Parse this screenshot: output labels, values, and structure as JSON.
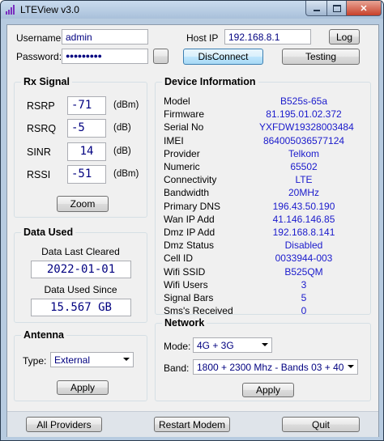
{
  "window": {
    "title": "LTEView v3.0"
  },
  "login": {
    "username_label": "Username:",
    "username_value": "admin",
    "password_label": "Password:",
    "password_value": "●●●●●●●●●",
    "host_label": "Host IP",
    "host_value": "192.168.8.1",
    "log_button": "Log",
    "disconnect_button": "DisConnect",
    "testing_button": "Testing"
  },
  "rx_signal": {
    "title": "Rx Signal",
    "rows": [
      {
        "label": "RSRP",
        "value": "-71",
        "unit": "(dBm)"
      },
      {
        "label": "RSRQ",
        "value": "-5",
        "unit": "(dB)"
      },
      {
        "label": "SINR",
        "value": "14",
        "unit": "(dB)"
      },
      {
        "label": "RSSI",
        "value": "-51",
        "unit": "(dBm)"
      }
    ],
    "zoom_button": "Zoom"
  },
  "data_used": {
    "title": "Data Used",
    "last_cleared_label": "Data Last Cleared",
    "last_cleared_value": "2022-01-01",
    "used_since_label": "Data Used Since",
    "used_since_value": "15.567 GB"
  },
  "antenna": {
    "title": "Antenna",
    "type_label": "Type:",
    "type_value": "External",
    "apply_button": "Apply"
  },
  "device_info": {
    "title": "Device Information",
    "rows": [
      {
        "label": "Model",
        "value": "B525s-65a"
      },
      {
        "label": "Firmware",
        "value": "81.195.01.02.372"
      },
      {
        "label": "Serial No",
        "value": "YXFDW19328003484"
      },
      {
        "label": "IMEI",
        "value": "864005036577124"
      },
      {
        "label": "Provider",
        "value": "Telkom"
      },
      {
        "label": "Numeric",
        "value": "65502"
      },
      {
        "label": "Connectivity",
        "value": "LTE"
      },
      {
        "label": "Bandwidth",
        "value": "20MHz"
      },
      {
        "label": "Primary DNS",
        "value": "196.43.50.190"
      },
      {
        "label": "Wan IP Add",
        "value": "41.146.146.85"
      },
      {
        "label": "Dmz IP Add",
        "value": "192.168.8.141"
      },
      {
        "label": "Dmz Status",
        "value": "Disabled"
      },
      {
        "label": "Cell ID",
        "value": "0033944-003"
      },
      {
        "label": "Wifi SSID",
        "value": "B525QM"
      },
      {
        "label": "Wifi Users",
        "value": "3"
      },
      {
        "label": "Signal Bars",
        "value": "5"
      },
      {
        "label": "Sms's Received",
        "value": "0"
      }
    ]
  },
  "network": {
    "title": "Network",
    "mode_label": "Mode:",
    "mode_value": "4G + 3G",
    "band_label": "Band:",
    "band_value": "1800 + 2300 Mhz - Bands 03 + 40",
    "apply_button": "Apply"
  },
  "footer": {
    "all_providers_button": "All Providers",
    "restart_button": "Restart Modem",
    "quit_button": "Quit"
  }
}
